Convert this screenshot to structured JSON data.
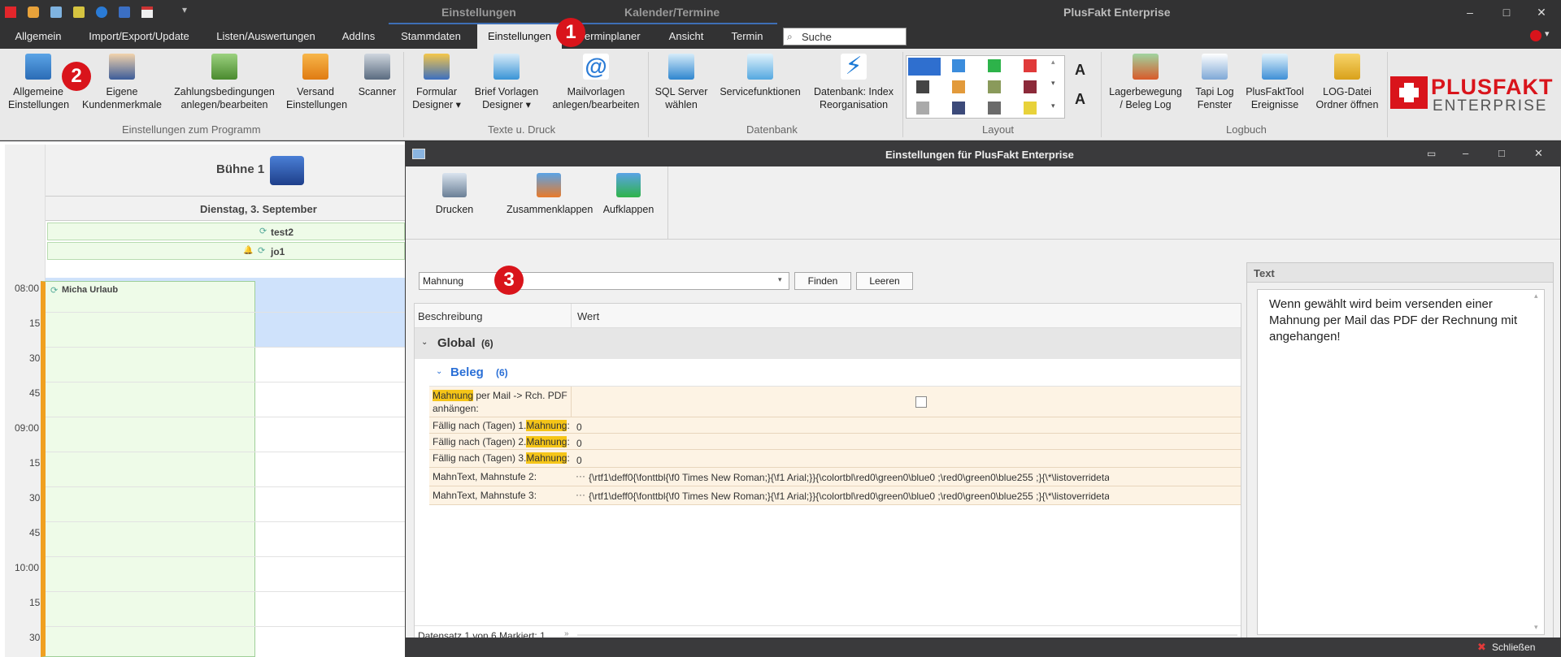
{
  "titlebar": {
    "context_tab_1": "Einstellungen",
    "context_tab_2": "Kalender/Termine",
    "app_title": "PlusFakt Enterprise",
    "min": "–",
    "max": "□",
    "close": "✕"
  },
  "tabs": [
    {
      "label": "Allgemein"
    },
    {
      "label": "Import/Export/Update"
    },
    {
      "label": "Listen/Auswertungen"
    },
    {
      "label": "AddIns"
    },
    {
      "label": "Stammdaten"
    },
    {
      "label": "Einstellungen"
    },
    {
      "label": "Terminplaner"
    },
    {
      "label": "Ansicht"
    },
    {
      "label": "Termin"
    }
  ],
  "search": {
    "value": "Suche"
  },
  "ribbon": {
    "b1": "Allgemeine\nEinstellungen",
    "b2": "Eigene\nKundenmerkmale",
    "b3": "Zahlungsbedingungen\nanlegen/bearbeiten",
    "b4": "Versand\nEinstellungen",
    "b5": "Scanner",
    "b6": "Formular\nDesigner ▾",
    "b7": "Brief Vorlagen\nDesigner ▾",
    "b8": "Mailvorlagen\nanlegen/bearbeiten",
    "b9": "SQL Server\nwählen",
    "b10": "Servicefunktionen",
    "b11": "Datenbank: Index\nReorganisation",
    "b12": "Lagerbewegung\n/ Beleg Log",
    "b13": "Tapi Log\nFenster",
    "b14": "PlusFaktTool\nEreignisse",
    "b15": "LOG-Datei\nOrdner öffnen",
    "g1": "Einstellungen zum Programm",
    "g2": "Texte u. Druck",
    "g3": "Datenbank",
    "g4": "Layout",
    "g5": "Logbuch",
    "logo_top": "PLUSFAKT",
    "logo_bottom": "ENTERPRISE"
  },
  "badges": {
    "one": "1",
    "two": "2",
    "three": "3"
  },
  "calendar": {
    "resource": "Bühne 1",
    "date": "Dienstag, 3. September",
    "allday1": "test2",
    "allday2": "jo1",
    "event": "Micha Urlaub",
    "times": [
      "08:00",
      "15",
      "30",
      "45",
      "09:00",
      "15",
      "30",
      "45",
      "10:00",
      "15",
      "30"
    ]
  },
  "dialog": {
    "title": "Einstellungen für PlusFakt Enterprise",
    "print": "Drucken",
    "collapse": "Zusammenklappen",
    "expand": "Aufklappen",
    "search_value": "Mahnung",
    "find": "Finden",
    "clear": "Leeren",
    "col_desc": "Beschreibung",
    "col_value": "Wert",
    "group_global": "Global",
    "group_global_count": "(6)",
    "group_beleg": "Beleg",
    "group_beleg_count": "(6)",
    "row1_hl": "Mahnung",
    "row1_rest": " per Mail -> Rch. PDF",
    "row1_line2": "anhängen:",
    "row2_pre": "Fällig nach (Tagen) 1.",
    "row3_pre": "Fällig nach (Tagen) 2.",
    "row4_pre": "Fällig nach (Tagen) 3.",
    "row_hl": "Mahnung",
    "row_suffix": ":",
    "row2_val": "0",
    "row3_val": "0",
    "row4_val": "0",
    "row5": "MahnText, Mahnstufe 2:",
    "row6": "MahnText, Mahnstufe 3:",
    "ellipsis": "···",
    "rtf": "{\\rtf1\\deff0{\\fonttbl{\\f0 Times New Roman;}{\\f1 Arial;}}{\\colortbl\\red0\\green0\\blue0 ;\\red0\\green0\\blue255 ;}{\\*\\listoverridetabl...",
    "status": "Datensatz 1 von 6 Markiert: 1",
    "text_panel_title": "Text",
    "text_panel_content": "Wenn gewählt wird beim versenden einer Mahnung per Mail das PDF der Rechnung mit angehangen!",
    "close_label": "Schließen"
  }
}
